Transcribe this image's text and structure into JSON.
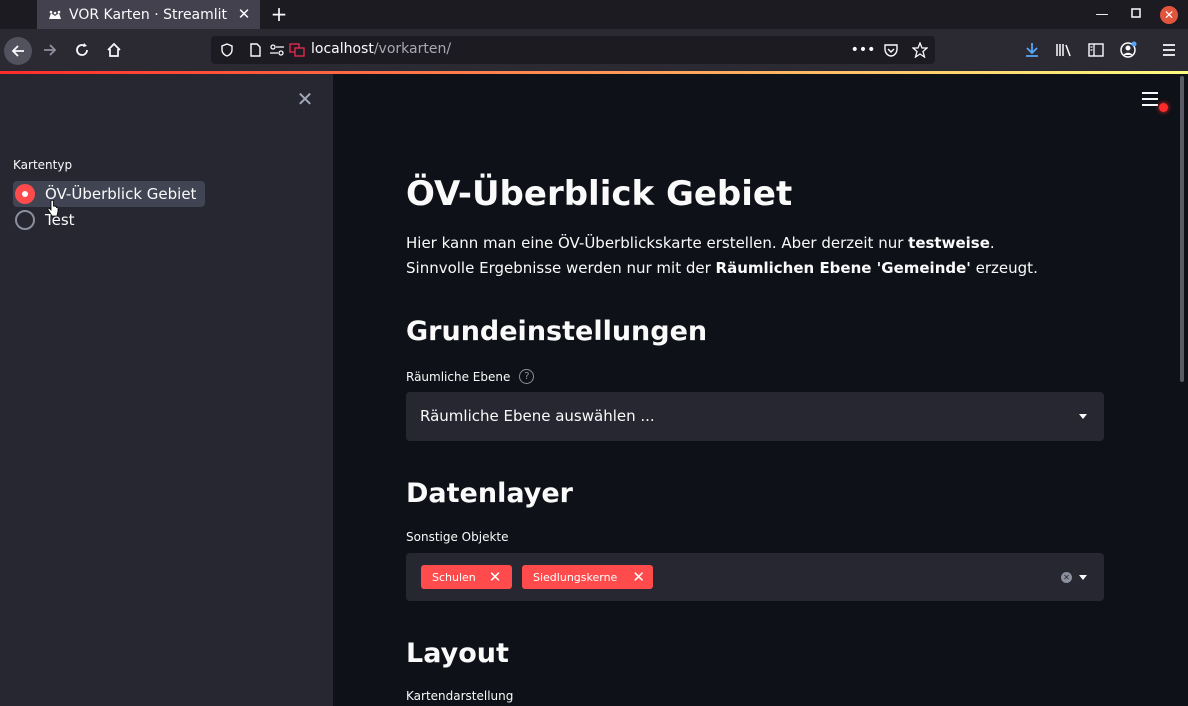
{
  "browser": {
    "tab_title": "VOR Karten · Streamlit",
    "url_host": "localhost",
    "url_path": "/vorkarten/"
  },
  "sidebar": {
    "radio_label": "Kartentyp",
    "options": [
      {
        "label": "ÖV-Überblick Gebiet",
        "selected": true
      },
      {
        "label": "Test",
        "selected": false
      }
    ]
  },
  "main": {
    "title": "ÖV-Überblick Gebiet",
    "intro": {
      "part1": "Hier kann man eine ÖV-Überblickskarte erstellen. Aber derzeit nur ",
      "bold1": "testweise",
      "part2": ". Sinnvolle Ergebnisse werden nur mit der ",
      "bold2": "Räumlichen Ebene 'Gemeinde'",
      "part3": " erzeugt."
    },
    "section_basic": "Grundeinstellungen",
    "spatial_label": "Räumliche Ebene",
    "spatial_help": "?",
    "spatial_placeholder": "Räumliche Ebene auswählen ...",
    "section_data": "Datenlayer",
    "other_label": "Sonstige Objekte",
    "chips": [
      "Schulen",
      "Siedlungskerne"
    ],
    "section_layout": "Layout",
    "map_label": "Kartendarstellung"
  },
  "colors": {
    "accent": "#ff4b4b",
    "background": "#0e1117",
    "sidebar": "#262730"
  }
}
